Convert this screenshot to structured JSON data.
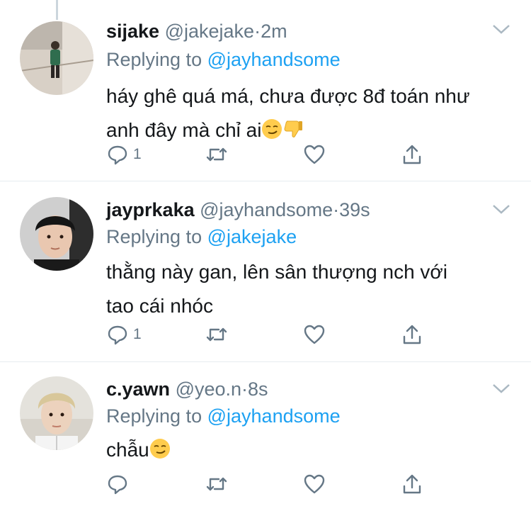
{
  "tweets": [
    {
      "name": "sijake",
      "handle": "@jakejake",
      "separator": "·",
      "time": "2m",
      "replying_prefix": "Replying to",
      "replying_to": "@jayhandsome",
      "text_line1": "háy ghê quá má, chưa được 8đ toán như",
      "text_line2": "anh đây mà chỉ ai",
      "emojis": [
        "smirking-face-emoji",
        "thumbs-down-emoji"
      ],
      "reply_count": "1"
    },
    {
      "name": "jayprkaka",
      "handle": "@jayhandsome",
      "separator": "·",
      "time": "39s",
      "replying_prefix": "Replying to",
      "replying_to": "@jakejake",
      "text_line1": "thằng này gan, lên sân thượng nch với",
      "text_line2": "tao cái nhóc",
      "reply_count": "1"
    },
    {
      "name": "c.yawn",
      "handle": "@yeo.n",
      "separator": "·",
      "time": "8s",
      "replying_prefix": "Replying to",
      "replying_to": "@jayhandsome",
      "text_line1": "chẫu",
      "emojis": [
        "smirking-face-emoji"
      ],
      "reply_count": ""
    }
  ],
  "colors": {
    "link": "#1da1f2",
    "muted": "#657786",
    "text": "#14171a",
    "divider": "#e6ecf0"
  },
  "icons": [
    "reply-icon",
    "retweet-icon",
    "like-icon",
    "share-icon",
    "chevron-down-icon"
  ]
}
